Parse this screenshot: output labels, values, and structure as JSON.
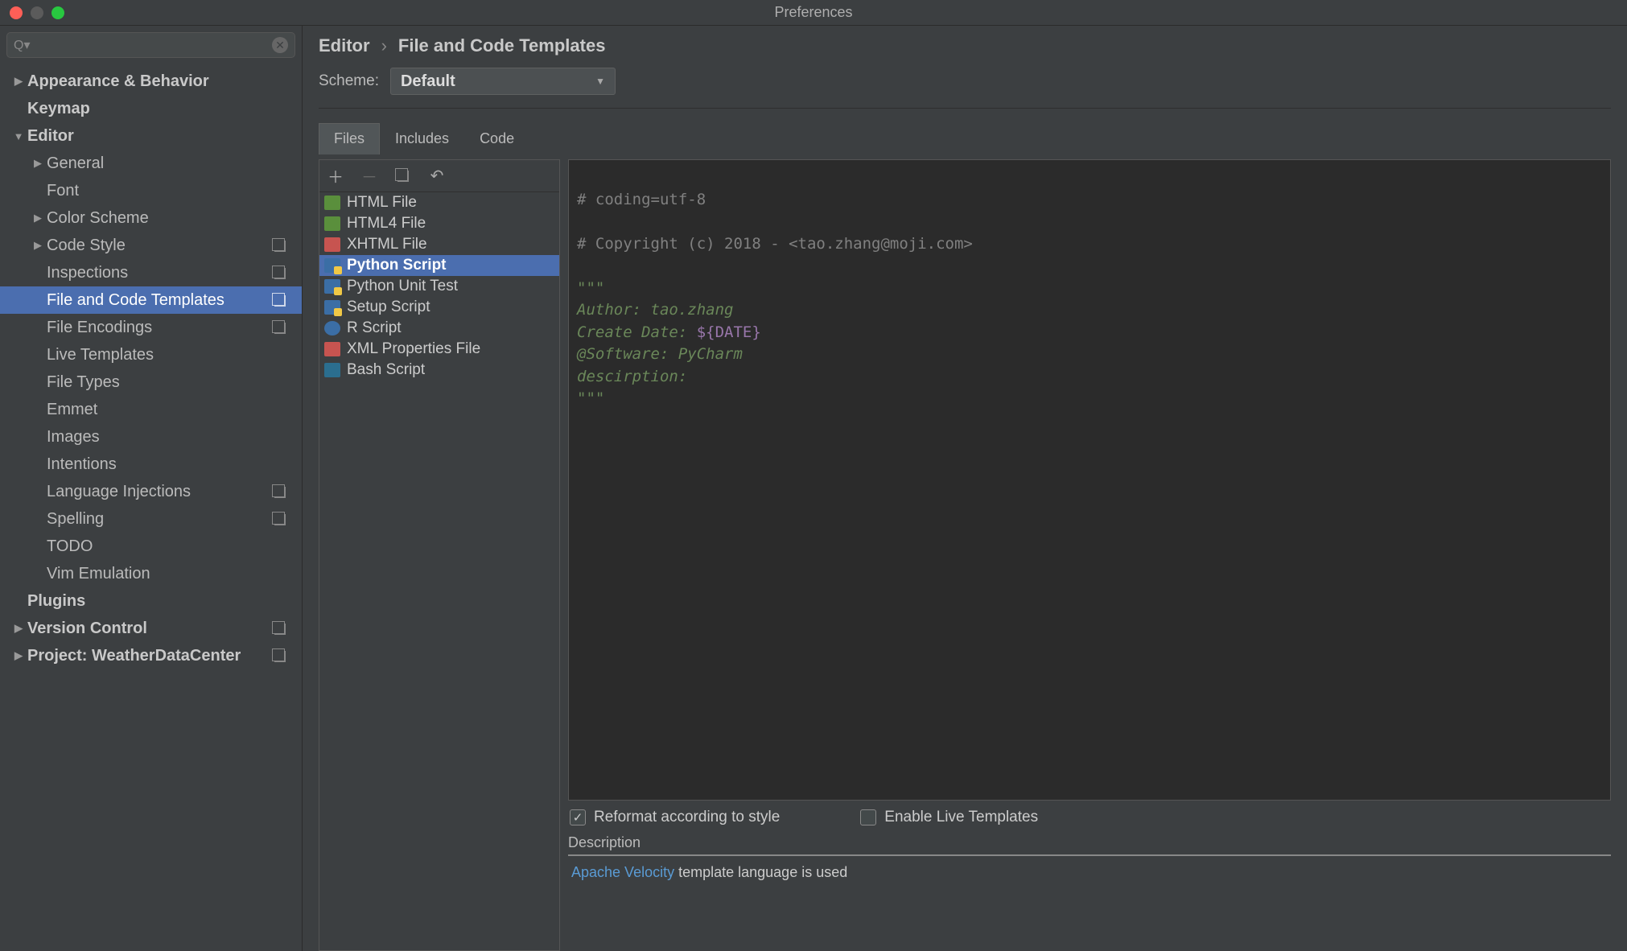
{
  "window_title": "Preferences",
  "search_placeholder": "",
  "sidebar": {
    "items": [
      {
        "label": "Appearance & Behavior",
        "level": 1,
        "bold": true,
        "exp": "▶",
        "suffix": false
      },
      {
        "label": "Keymap",
        "level": 1,
        "bold": true,
        "exp": "",
        "suffix": false
      },
      {
        "label": "Editor",
        "level": 1,
        "bold": true,
        "exp": "▼",
        "suffix": false
      },
      {
        "label": "General",
        "level": 2,
        "bold": false,
        "exp": "▶",
        "suffix": false
      },
      {
        "label": "Font",
        "level": 2,
        "bold": false,
        "exp": "",
        "suffix": false
      },
      {
        "label": "Color Scheme",
        "level": 2,
        "bold": false,
        "exp": "▶",
        "suffix": false
      },
      {
        "label": "Code Style",
        "level": 2,
        "bold": false,
        "exp": "▶",
        "suffix": true
      },
      {
        "label": "Inspections",
        "level": 2,
        "bold": false,
        "exp": "",
        "suffix": true
      },
      {
        "label": "File and Code Templates",
        "level": 2,
        "bold": false,
        "exp": "",
        "suffix": true,
        "selected": true
      },
      {
        "label": "File Encodings",
        "level": 2,
        "bold": false,
        "exp": "",
        "suffix": true
      },
      {
        "label": "Live Templates",
        "level": 2,
        "bold": false,
        "exp": "",
        "suffix": false
      },
      {
        "label": "File Types",
        "level": 2,
        "bold": false,
        "exp": "",
        "suffix": false
      },
      {
        "label": "Emmet",
        "level": 2,
        "bold": false,
        "exp": "",
        "suffix": false
      },
      {
        "label": "Images",
        "level": 2,
        "bold": false,
        "exp": "",
        "suffix": false
      },
      {
        "label": "Intentions",
        "level": 2,
        "bold": false,
        "exp": "",
        "suffix": false
      },
      {
        "label": "Language Injections",
        "level": 2,
        "bold": false,
        "exp": "",
        "suffix": true
      },
      {
        "label": "Spelling",
        "level": 2,
        "bold": false,
        "exp": "",
        "suffix": true
      },
      {
        "label": "TODO",
        "level": 2,
        "bold": false,
        "exp": "",
        "suffix": false
      },
      {
        "label": "Vim Emulation",
        "level": 2,
        "bold": false,
        "exp": "",
        "suffix": false
      },
      {
        "label": "Plugins",
        "level": 1,
        "bold": true,
        "exp": "",
        "suffix": false
      },
      {
        "label": "Version Control",
        "level": 1,
        "bold": true,
        "exp": "▶",
        "suffix": true
      },
      {
        "label": "Project: WeatherDataCenter",
        "level": 1,
        "bold": true,
        "exp": "▶",
        "suffix": true
      }
    ]
  },
  "breadcrumb": {
    "parent": "Editor",
    "sep": "›",
    "child": "File and Code Templates"
  },
  "scheme": {
    "label": "Scheme:",
    "value": "Default"
  },
  "tabs": [
    {
      "label": "Files",
      "active": true
    },
    {
      "label": "Includes"
    },
    {
      "label": "Code"
    }
  ],
  "templates": [
    {
      "label": "HTML File",
      "icon": "html"
    },
    {
      "label": "HTML4 File",
      "icon": "html4"
    },
    {
      "label": "XHTML File",
      "icon": "xhtml"
    },
    {
      "label": "Python Script",
      "icon": "py",
      "selected": true
    },
    {
      "label": "Python Unit Test",
      "icon": "py"
    },
    {
      "label": "Setup Script",
      "icon": "py"
    },
    {
      "label": "R Script",
      "icon": "r"
    },
    {
      "label": "XML Properties File",
      "icon": "xml"
    },
    {
      "label": "Bash Script",
      "icon": "bash"
    }
  ],
  "code": {
    "line1": "# coding=utf-8",
    "line2": "# Copyright (c) 2018 - <tao.zhang@moji.com>",
    "line3": "\"\"\"",
    "line4": "Author: tao.zhang",
    "line5a": "Create Date: ",
    "line5b": "${DATE}",
    "line6": "@Software: PyCharm",
    "line7": "descirption:",
    "line8": "\"\"\""
  },
  "checks": {
    "reformat": {
      "label": "Reformat according to style",
      "checked": true
    },
    "live": {
      "label": "Enable Live Templates",
      "checked": false
    }
  },
  "description": {
    "label": "Description",
    "link": "Apache Velocity",
    "text": " template language is used"
  }
}
